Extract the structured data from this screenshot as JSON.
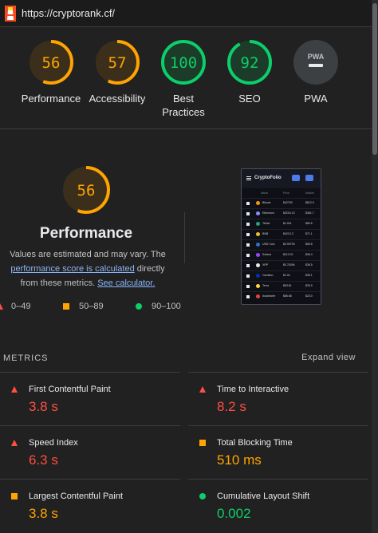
{
  "address_bar": {
    "url": "https://cryptorank.cf/"
  },
  "colors": {
    "fail": "#ff4e42",
    "average": "#ffa400",
    "pass": "#0cce6b",
    "link": "#8ab4f8"
  },
  "gauges": [
    {
      "score": "56",
      "label": "Performance",
      "rating": "average",
      "fraction": 0.56
    },
    {
      "score": "57",
      "label": "Accessibility",
      "rating": "average",
      "fraction": 0.57
    },
    {
      "score": "100",
      "label": "Best Practices",
      "label_line1": "Best",
      "label_line2": "Practices",
      "rating": "pass",
      "fraction": 1.0
    },
    {
      "score": "92",
      "label": "SEO",
      "rating": "pass",
      "fraction": 0.92
    },
    {
      "score": "PWA",
      "label": "PWA",
      "rating": "na",
      "icon": "pwa-badge-icon"
    }
  ],
  "performance": {
    "score": "56",
    "fraction": 0.56,
    "title": "Performance",
    "desc_part1": "Values are estimated and may vary. The",
    "desc_link1": "performance score is calculated",
    "desc_part2": "directly from these metrics.",
    "desc_link2": "See calculator."
  },
  "legend": [
    {
      "range": "0–49",
      "icon": "fail-triangle-icon"
    },
    {
      "range": "50–89",
      "icon": "average-square-icon"
    },
    {
      "range": "90–100",
      "icon": "pass-circle-icon"
    }
  ],
  "thumbnail": {
    "app_title": "CryptoFolio",
    "columns": [
      "Name",
      "Price",
      "Market"
    ],
    "rows": [
      {
        "name": "Bitcoin",
        "price": "$42750",
        "mcap": "$812.9",
        "color": "#f7931a"
      },
      {
        "name": "Ethereum",
        "price": "$3204.13",
        "mcap": "$381.7",
        "color": "#8c8cff"
      },
      {
        "name": "Tether",
        "price": "$1.001",
        "mcap": "$80.6",
        "color": "#26a17b"
      },
      {
        "name": "BNB",
        "price": "$423.13",
        "mcap": "$71.1",
        "color": "#f3ba2f"
      },
      {
        "name": "USD Coin",
        "price": "$0.99709",
        "mcap": "$50.8",
        "color": "#2775ca"
      },
      {
        "name": "Solana",
        "price": "$112.02",
        "mcap": "$36.4",
        "color": "#9945ff"
      },
      {
        "name": "XRP",
        "price": "$0.76394",
        "mcap": "$36.5",
        "color": "#e8eaed"
      },
      {
        "name": "Cardano",
        "price": "$1.04",
        "mcap": "$35.1",
        "color": "#0033ad"
      },
      {
        "name": "Terra",
        "price": "$93.81",
        "mcap": "$33.9",
        "color": "#ffd83d"
      },
      {
        "name": "Avalanche",
        "price": "$86.68",
        "mcap": "$23.0",
        "color": "#e84142"
      }
    ]
  },
  "metrics": {
    "title": "METRICS",
    "expand_label": "Expand view",
    "items": [
      {
        "label": "First Contentful Paint",
        "value": "3.8 s",
        "rating": "fail"
      },
      {
        "label": "Time to Interactive",
        "value": "8.2 s",
        "rating": "fail"
      },
      {
        "label": "Speed Index",
        "value": "6.3 s",
        "rating": "fail"
      },
      {
        "label": "Total Blocking Time",
        "value": "510 ms",
        "rating": "average"
      },
      {
        "label": "Largest Contentful Paint",
        "value": "3.8 s",
        "rating": "average"
      },
      {
        "label": "Cumulative Layout Shift",
        "value": "0.002",
        "rating": "pass"
      }
    ]
  }
}
